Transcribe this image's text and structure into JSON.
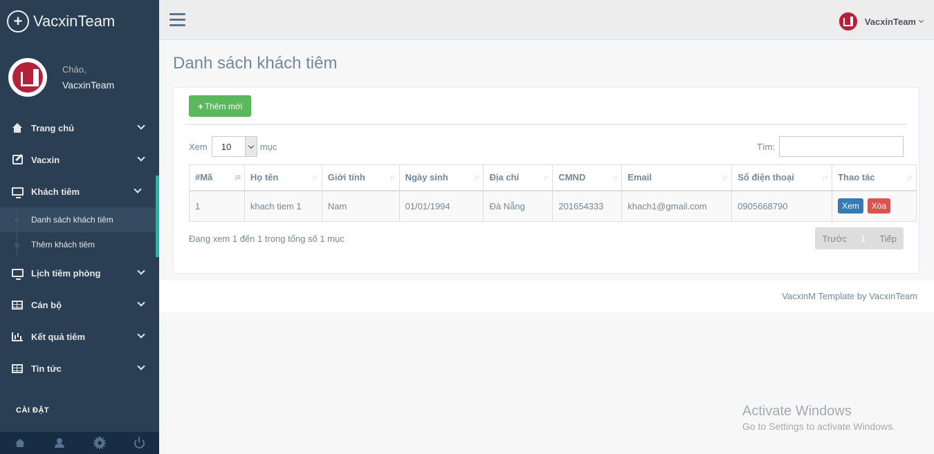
{
  "brand": {
    "name": "VacxinTeam"
  },
  "profile": {
    "greeting": "Chào,",
    "name": "VacxinTeam"
  },
  "sidebar": {
    "items": [
      {
        "label": "Trang chủ",
        "icon": "home-icon"
      },
      {
        "label": "Vacxin",
        "icon": "edit-icon"
      },
      {
        "label": "Khách tiêm",
        "icon": "desktop-icon",
        "active": true,
        "children": [
          {
            "label": "Danh sách khách tiêm",
            "current": true
          },
          {
            "label": "Thêm khách tiêm"
          }
        ]
      },
      {
        "label": "Lịch tiêm phòng",
        "icon": "desktop-icon"
      },
      {
        "label": "Cán bộ",
        "icon": "table-icon"
      },
      {
        "label": "Kết quả tiêm",
        "icon": "bar-chart-icon"
      },
      {
        "label": "Tin tức",
        "icon": "table-icon"
      }
    ],
    "settings_label": "CÀI ĐẶT",
    "footer_icons": [
      "home-icon",
      "user-icon",
      "gear-icon",
      "power-icon"
    ]
  },
  "topnav": {
    "user_name": "VacxinTeam"
  },
  "main": {
    "title": "Danh sách khách tiêm",
    "add_button": "Thêm mới",
    "length": {
      "prefix": "Xem",
      "value": "10",
      "suffix": "mục"
    },
    "search_label": "Tìm:",
    "columns": [
      "#Mã",
      "Họ tên",
      "Giới tính",
      "Ngày sinh",
      "Địa chỉ",
      "CMND",
      "Email",
      "Số điện thoại",
      "Thao tác"
    ],
    "rows": [
      {
        "ma": "1",
        "ho_ten": "khach tiem 1",
        "gioi_tinh": "Nam",
        "ngay_sinh": "01/01/1994",
        "dia_chi": "Đà Nẵng",
        "cmnd": "201654333",
        "email": "khach1@gmail.com",
        "sdt": "0905668790",
        "view_label": "Xem",
        "delete_label": "Xóa"
      }
    ],
    "info": "Đang xem 1 đến 1 trong tổng số 1 mục",
    "pager": {
      "prev": "Trước",
      "page": "1",
      "next": "Tiếp"
    }
  },
  "footer": {
    "text": "VacxinM Template by VacxinTeam"
  },
  "watermark": {
    "line1": "Activate Windows",
    "line2": "Go to Settings to activate Windows."
  },
  "colors": {
    "sidebar": "#2a3f54",
    "accent": "#1abb9c",
    "add_button": "#5cb85c",
    "view_button": "#337ab7",
    "delete_button": "#d9534f"
  }
}
